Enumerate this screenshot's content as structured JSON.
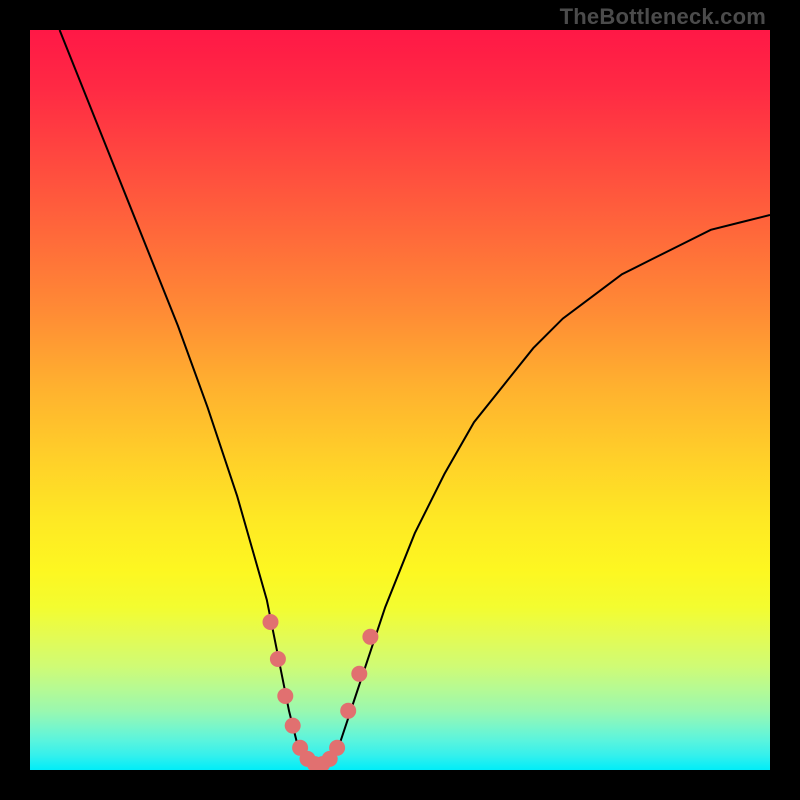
{
  "watermark": "TheBottleneck.com",
  "chart_data": {
    "type": "line",
    "title": "",
    "xlabel": "",
    "ylabel": "",
    "xlim": [
      0,
      100
    ],
    "ylim": [
      0,
      100
    ],
    "grid": false,
    "legend": false,
    "series": [
      {
        "name": "bottleneck-curve",
        "x": [
          4,
          8,
          12,
          16,
          20,
          24,
          28,
          30,
          32,
          33,
          34,
          35,
          36,
          37,
          38,
          39,
          40,
          41,
          42,
          44,
          48,
          52,
          56,
          60,
          64,
          68,
          72,
          76,
          80,
          84,
          88,
          92,
          96,
          100
        ],
        "y": [
          100,
          90,
          80,
          70,
          60,
          49,
          37,
          30,
          23,
          18,
          13,
          8,
          4,
          1.5,
          0.5,
          0.5,
          0.5,
          1.5,
          4,
          10,
          22,
          32,
          40,
          47,
          52,
          57,
          61,
          64,
          67,
          69,
          71,
          73,
          74,
          75
        ]
      }
    ],
    "markers": {
      "name": "highlighted-points",
      "points": [
        {
          "x": 32.5,
          "y": 20
        },
        {
          "x": 33.5,
          "y": 15
        },
        {
          "x": 34.5,
          "y": 10
        },
        {
          "x": 35.5,
          "y": 6
        },
        {
          "x": 36.5,
          "y": 3
        },
        {
          "x": 37.5,
          "y": 1.5
        },
        {
          "x": 38.5,
          "y": 0.8
        },
        {
          "x": 39.5,
          "y": 0.8
        },
        {
          "x": 40.5,
          "y": 1.5
        },
        {
          "x": 41.5,
          "y": 3
        },
        {
          "x": 43,
          "y": 8
        },
        {
          "x": 44.5,
          "y": 13
        },
        {
          "x": 46,
          "y": 18
        }
      ]
    },
    "background_gradient": {
      "top": "#ff1846",
      "mid": "#fee824",
      "bottom": "#00edf8"
    }
  }
}
